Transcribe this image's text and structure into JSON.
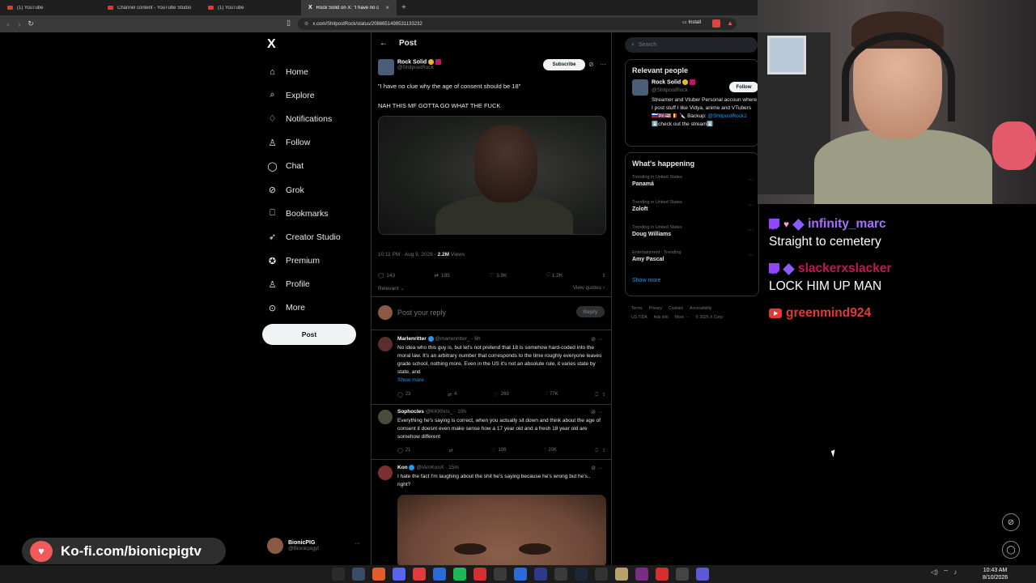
{
  "browser": {
    "tabs": [
      {
        "label": "(1) YouTube",
        "icon": "youtube-icon"
      },
      {
        "label": "Channel content - YouTube Studio",
        "icon": "youtube-studio-icon"
      },
      {
        "label": "(1) YouTube",
        "icon": "youtube-icon"
      },
      {
        "label": "Rock Solid on X: \"I have no c",
        "icon": "x-icon"
      }
    ],
    "url": "x.com/ShitpostRock/status/2086651499531133232",
    "install_label": "Install"
  },
  "nav": {
    "logo": "X",
    "items": [
      {
        "label": "Home",
        "icon": "home-icon",
        "glyph": "⌂"
      },
      {
        "label": "Explore",
        "icon": "search-icon",
        "glyph": "⌕"
      },
      {
        "label": "Notifications",
        "icon": "bell-icon",
        "glyph": "♢"
      },
      {
        "label": "Follow",
        "icon": "person-plus-icon",
        "glyph": "♙"
      },
      {
        "label": "Chat",
        "icon": "chat-icon",
        "glyph": "◯"
      },
      {
        "label": "Grok",
        "icon": "grok-icon",
        "glyph": "⊘"
      },
      {
        "label": "Bookmarks",
        "icon": "bookmark-icon",
        "glyph": "⎕"
      },
      {
        "label": "Creator Studio",
        "icon": "rocket-icon",
        "glyph": "➶"
      },
      {
        "label": "Premium",
        "icon": "verified-icon",
        "glyph": "✪"
      },
      {
        "label": "Profile",
        "icon": "profile-icon",
        "glyph": "♙"
      },
      {
        "label": "More",
        "icon": "more-circle-icon",
        "glyph": "⊙"
      }
    ],
    "post_button": "Post",
    "account": {
      "name": "BionicPIG",
      "handle": "@Bionicpigyt"
    }
  },
  "post": {
    "header": "Post",
    "author_name": "Rock Solid",
    "author_handle": "@ShitpostRock",
    "subscribe_label": "Subscribe",
    "text1": "\"I have no clue why the age of consent should be 18\"",
    "text2": "NAH THIS MF GOTTA GO WHAT THE FUCK",
    "time": "10:11 PM · Aug 9, 2026 · ",
    "views": "2.2M",
    "views_label": " Views",
    "replies": "143",
    "reposts": "195",
    "likes": "3.9K",
    "bookmarks": "1.2K",
    "sort_label": "Relevant",
    "view_quotes": "View quotes",
    "reply_placeholder": "Post your reply",
    "reply_button": "Reply"
  },
  "replies": [
    {
      "name": "Marlenritter",
      "handle": "@marlenritter_ · 6h",
      "text": "No idea who this guy is, but let's not pretend that 18 is somehow hard-coded into the moral law. It's an arbitrary number that corresponds to the time roughly everyone leaves grade school, nothing more. Even in the US it's not an absolute rule, it varies state by state, and",
      "show_more": "Show more",
      "replies": "23",
      "reposts": "4",
      "likes": "269",
      "views": "77K"
    },
    {
      "name": "Sophocles",
      "handle": "@KKKhris_ · 10h",
      "text": "Everything he's saying is correct, when you actually sit down and think about the age of consent it doesnt even make sense how a 17 year old and a fresh 18 year old are somehow different",
      "replies": "21",
      "reposts": "",
      "likes": "106",
      "views": "20K"
    },
    {
      "name": "Kon",
      "handle": "@IAmKonX · 15m",
      "text": "I hate the fact I'm laughing about the shit he's saying because he's wrong but he's.. right?"
    }
  ],
  "sidebar": {
    "search_placeholder": "Search",
    "relevant_title": "Relevant people",
    "relevant_name": "Rock Solid",
    "relevant_handle": "@ShitpostRock",
    "follow_label": "Follow",
    "bio_part1": "Streamer and Vtuber Personal accoun where I post stuff I like Vidya, anime and VTubers 🇷🇺🇬🇧🇺🇸🇧🇪 🔪 Backup: ",
    "bio_link": "@ShitpostRock2",
    "bio_part2": " ⬇️check out the stream⬇️",
    "happening_title": "What's happening",
    "trends": [
      {
        "context": "Trending in United States",
        "name": "Panamá"
      },
      {
        "context": "Trending in United States",
        "name": "Zoloft"
      },
      {
        "context": "Trending in United States",
        "name": "Doug Williams"
      },
      {
        "context": "Entertainment · Trending",
        "name": "Amy Pascal"
      }
    ],
    "show_more": "Show more",
    "footer_line1": [
      "Terms",
      "Privacy",
      "Cookies",
      "Accessibility"
    ],
    "footer_line2": [
      "US TIDA",
      "Ads info",
      "More ···",
      "© 2026 X Corp."
    ]
  },
  "stream": {
    "chat": [
      {
        "user": "infinity_marc",
        "user_color": "#a970ff",
        "platform": "twitch",
        "message": "Straight to cemetery"
      },
      {
        "user": "slackerxslacker",
        "user_color": "#c2185b",
        "platform": "twitch",
        "message": "LOCK HIM UP MAN"
      },
      {
        "user": "greenmind924",
        "user_color": "#e53935",
        "platform": "youtube",
        "message": ""
      }
    ],
    "kofi": "Ko-fi.com/bionicpigtv"
  },
  "taskbar": {
    "time": "10:43 AM",
    "date": "8/10/2026"
  }
}
